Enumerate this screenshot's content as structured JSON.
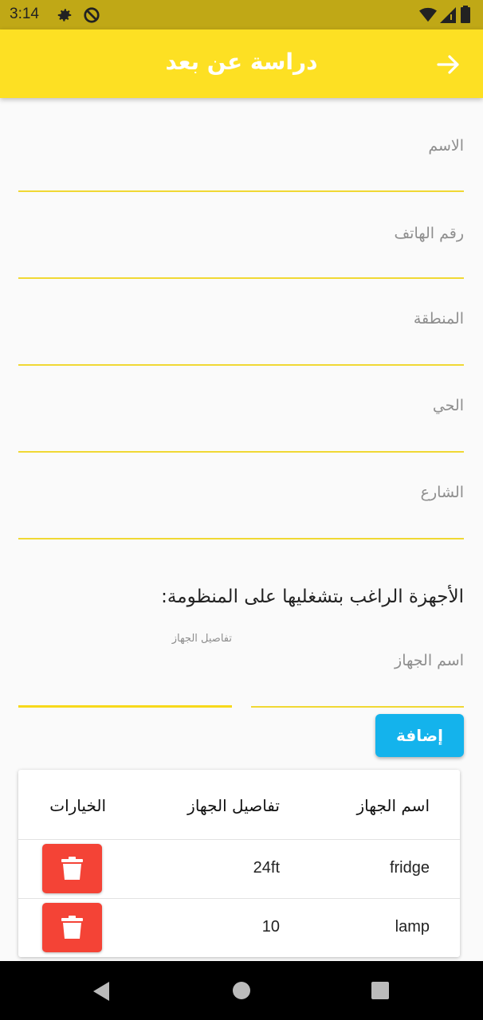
{
  "status_bar": {
    "time": "3:14"
  },
  "app_bar": {
    "title": "دراسة عن بعد"
  },
  "form": {
    "fields": [
      {
        "label": "الاسم"
      },
      {
        "label": "رقم الهاتف"
      },
      {
        "label": "المنطقة"
      },
      {
        "label": "الحي"
      },
      {
        "label": "الشارع"
      }
    ],
    "devices_section_title": "الأجهزة الراغب بتشغليها على المنظومة:",
    "device_details_label": "تفاصيل الجهاز",
    "device_name_label": "اسم الجهاز",
    "add_button": "إضافة"
  },
  "table": {
    "headers": {
      "name": "اسم الجهاز",
      "details": "تفاصيل الجهاز",
      "options": "الخيارات"
    },
    "rows": [
      {
        "name": "fridge",
        "details": "24ft"
      },
      {
        "name": "lamp",
        "details": "10"
      }
    ]
  },
  "colors": {
    "accent": "#fde023",
    "status_bar": "#c0a816",
    "add_button": "#14b3ec",
    "delete": "#f44336"
  }
}
